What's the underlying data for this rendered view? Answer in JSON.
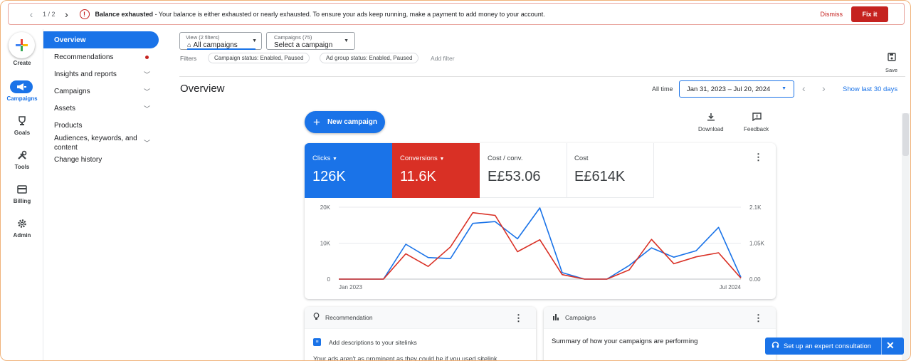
{
  "banner": {
    "pager": "1 / 2",
    "title": "Balance exhausted",
    "message": " - Your balance is either exhausted or nearly exhausted. To ensure your ads keep running, make a payment to add money to your account.",
    "dismiss": "Dismiss",
    "fix": "Fix it"
  },
  "rail": {
    "create": "Create",
    "campaigns": "Campaigns",
    "goals": "Goals",
    "tools": "Tools",
    "billing": "Billing",
    "admin": "Admin"
  },
  "nav": {
    "overview": "Overview",
    "recommendations": "Recommendations",
    "insights": "Insights and reports",
    "campaigns": "Campaigns",
    "assets": "Assets",
    "products": "Products",
    "audiences_1": "Audiences, keywords, and",
    "audiences_2": "content",
    "history": "Change history"
  },
  "filterbar": {
    "view_small": "View (2 filters)",
    "view_value": "All campaigns",
    "camp_small": "Campaigns (75)",
    "camp_value": "Select a campaign",
    "filters_label": "Filters",
    "chip1": "Campaign status: Enabled, Paused",
    "chip2": "Ad group status: Enabled, Paused",
    "add_filter": "Add filter",
    "save": "Save"
  },
  "header": {
    "title": "Overview",
    "all_time": "All time",
    "date_range": "Jan 31, 2023 – Jul 20, 2024",
    "show_last": "Show last 30 days"
  },
  "toolbar": {
    "new_campaign": "New campaign",
    "download": "Download",
    "feedback": "Feedback"
  },
  "metrics": {
    "clicks_label": "Clicks",
    "clicks_value": "126K",
    "conv_label": "Conversions",
    "conv_value": "11.6K",
    "cpc_label": "Cost / conv.",
    "cpc_value": "E£53.06",
    "cost_label": "Cost",
    "cost_value": "E£614K"
  },
  "chart_data": {
    "type": "line",
    "x": [
      "Jan 2023",
      "",
      "",
      "",
      "",
      "",
      "",
      "",
      "",
      "",
      "",
      "",
      "",
      "",
      "",
      "",
      "",
      "",
      "Jul 2024"
    ],
    "xticks": [
      "Jan 2023",
      "Jul 2024"
    ],
    "yticks_left": [
      "20K",
      "10K",
      "0"
    ],
    "yticks_right": [
      "2.1K",
      "1.05K",
      "0.00"
    ],
    "ylim_left": [
      0,
      20000
    ],
    "ylim_right": [
      0,
      2100
    ],
    "series": [
      {
        "axis": "left",
        "color": "#1a73e8",
        "values": [
          0,
          0,
          0,
          9700,
          6000,
          5700,
          15500,
          16000,
          11200,
          19800,
          1800,
          0,
          0,
          3800,
          8700,
          6100,
          7900,
          14400,
          500
        ]
      },
      {
        "axis": "right",
        "color": "#d93025",
        "values": [
          0,
          0,
          0,
          740,
          370,
          940,
          1940,
          1860,
          800,
          1150,
          130,
          0,
          0,
          270,
          1160,
          450,
          650,
          770,
          30
        ]
      }
    ],
    "grid": true
  },
  "recommendation": {
    "title": "Recommendation",
    "item": "Add descriptions to your sitelinks",
    "sub": "Your ads aren't as prominent as they could be if you used sitelink"
  },
  "campaigns_card": {
    "title": "Campaigns",
    "summary": "Summary of how your campaigns are performing"
  },
  "expert": {
    "label": "Set up an expert consultation"
  }
}
